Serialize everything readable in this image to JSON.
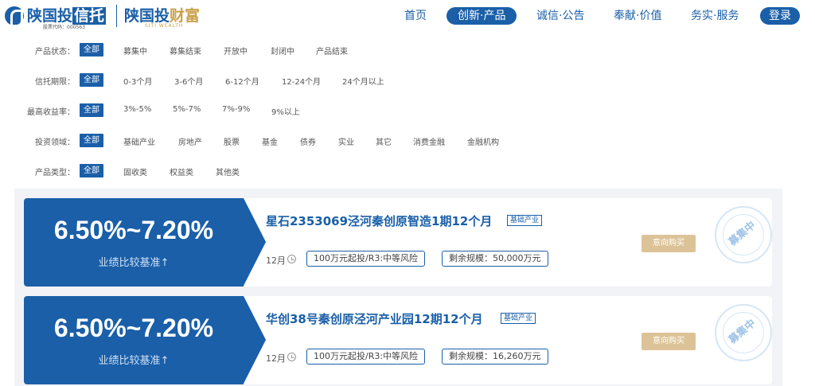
{
  "header": {
    "brand1_prefix": "陕国投",
    "brand1_highlight": "信托",
    "brand1_sub": "股票代码：000563",
    "brand2_prefix": "陕国投",
    "brand2_gold": "财富",
    "brand2_sub": "SITI WEALTH",
    "nav": [
      "首页",
      "创新·产品",
      "诚信·公告",
      "奉献·价值",
      "务实·服务"
    ],
    "active_nav": "创新·产品",
    "login": "登录"
  },
  "filters": [
    {
      "label": "产品状态：",
      "options": [
        "全部",
        "募集中",
        "募集结束",
        "开放中",
        "封闭中",
        "产品结束"
      ]
    },
    {
      "label": "信托期限：",
      "options": [
        "全部",
        "0-3个月",
        "3-6个月",
        "6-12个月",
        "12-24个月",
        "24个月以上"
      ]
    },
    {
      "label": "最高收益率：",
      "options": [
        "全部",
        "3%-5%",
        "5%-7%",
        "7%-9%",
        "9%以上"
      ]
    },
    {
      "label": "投资领域：",
      "options": [
        "全部",
        "基础产业",
        "房地产",
        "股票",
        "基金",
        "债券",
        "实业",
        "其它",
        "消费金融",
        "金融机构"
      ]
    },
    {
      "label": "产品类型：",
      "options": [
        "全部",
        "固收类",
        "权益类",
        "其他类"
      ]
    }
  ],
  "products": [
    {
      "rate": "6.50%~7.20%",
      "rate_label": "业绩比较基准↑",
      "title": "星石2353069泾河秦创原智造1期12个月",
      "tag": "基础产业",
      "term": "12月",
      "risk": "100万元起投/R3:中等风险",
      "remaining": "剩余规模：50,000万元",
      "buy": "意向购买",
      "stamp": "募集中"
    },
    {
      "rate": "6.50%~7.20%",
      "rate_label": "业绩比较基准↑",
      "title": "华创38号秦创原泾河产业园12期12个月",
      "tag": "基础产业",
      "term": "12月",
      "risk": "100万元起投/R3:中等风险",
      "remaining": "剩余规模：16,260万元",
      "buy": "意向购买",
      "stamp": "募集中"
    }
  ],
  "colors": {
    "brand": "#1a5fa8",
    "gold": "#c9a14a",
    "buy_button": "#dcc397"
  }
}
